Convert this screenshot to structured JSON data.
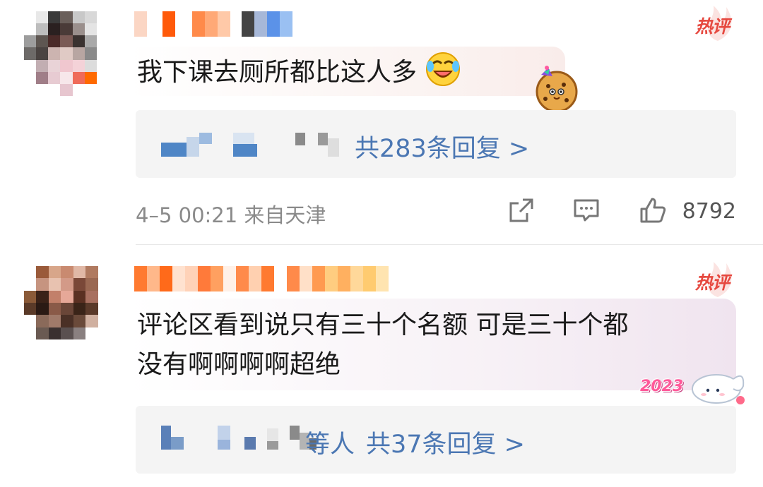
{
  "comments": [
    {
      "badge": "热评",
      "text": "我下课去厕所都比这人多",
      "emoji": "laughing-tears-emoji",
      "sticker": "cookie-sticker",
      "replies_label": "共283条回复 >",
      "time": "4–5 00:21",
      "location": "来自天津",
      "likes": "8792"
    },
    {
      "badge": "热评",
      "text_line1": "评论区看到说只有三十个名额 可是三十个都",
      "text_line2": "没有啊啊啊啊超绝",
      "sticker": "2023-cinnamoroll-sticker",
      "sticker_text": "2023",
      "replies_suffix": "等人",
      "replies_label": "共37条回复 >"
    }
  ],
  "icons": {
    "share": "share-icon",
    "comment": "comment-icon",
    "like": "thumbs-up-icon"
  },
  "colors": {
    "link": "#4b77b3",
    "hot": "#e6483f",
    "meta": "#8a8a8a"
  }
}
